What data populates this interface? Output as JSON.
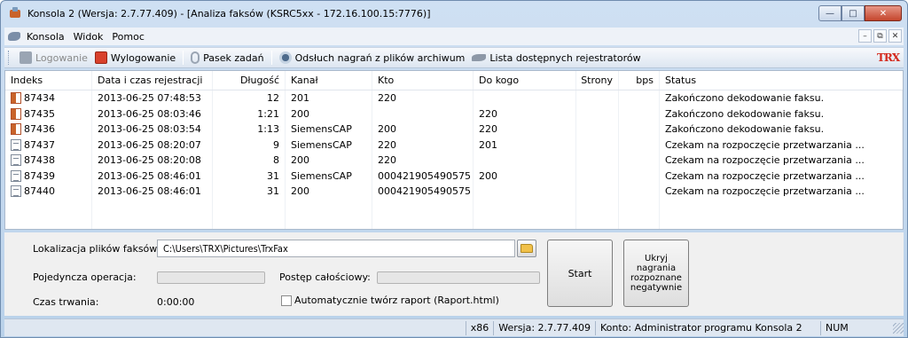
{
  "window": {
    "title": "Konsola 2 (Wersja:  2.7.77.409) - [Analiza faksów (KSRC5xx - 172.16.100.15:7776)]"
  },
  "menu": {
    "items": [
      "Konsola",
      "Widok",
      "Pomoc"
    ]
  },
  "toolbar": {
    "login": "Logowanie",
    "logout": "Wylogowanie",
    "taskbar": "Pasek zadań",
    "listen": "Odsłuch nagrań z plików archiwum",
    "recorders": "Lista dostępnych rejestratorów",
    "logo": "TRX"
  },
  "table": {
    "headers": [
      "Indeks",
      "Data i czas rejestracji",
      "Długość",
      "Kanał",
      "Kto",
      "Do kogo",
      "Strony",
      "bps",
      "Status"
    ],
    "rows": [
      {
        "icon": "fax-icon",
        "id": "87434",
        "date": "2013-06-25 07:48:53",
        "len": "12",
        "channel": "201",
        "who": "220",
        "to": "",
        "pages": "",
        "bps": "",
        "status": "Zakończono dekodowanie faksu."
      },
      {
        "icon": "fax-icon",
        "id": "87435",
        "date": "2013-06-25 08:03:46",
        "len": "1:21",
        "channel": "200",
        "who": "",
        "to": "220",
        "pages": "",
        "bps": "",
        "status": "Zakończono dekodowanie faksu."
      },
      {
        "icon": "fax-icon",
        "id": "87436",
        "date": "2013-06-25 08:03:54",
        "len": "1:13",
        "channel": "SiemensCAP",
        "who": "200",
        "to": "220",
        "pages": "",
        "bps": "",
        "status": "Zakończono dekodowanie faksu."
      },
      {
        "icon": "document-icon",
        "id": "87437",
        "date": "2013-06-25 08:20:07",
        "len": "9",
        "channel": "SiemensCAP",
        "who": "220",
        "to": "201",
        "pages": "",
        "bps": "",
        "status": "Czekam na rozpoczęcie przetwarzania ..."
      },
      {
        "icon": "document-icon",
        "id": "87438",
        "date": "2013-06-25 08:20:08",
        "len": "8",
        "channel": "200",
        "who": "220",
        "to": "",
        "pages": "",
        "bps": "",
        "status": "Czekam na rozpoczęcie przetwarzania ..."
      },
      {
        "icon": "document-icon",
        "id": "87439",
        "date": "2013-06-25 08:46:01",
        "len": "31",
        "channel": "SiemensCAP",
        "who": "000421905490575",
        "to": "200",
        "pages": "",
        "bps": "",
        "status": "Czekam na rozpoczęcie przetwarzania ..."
      },
      {
        "icon": "document-icon",
        "id": "87440",
        "date": "2013-06-25 08:46:01",
        "len": "31",
        "channel": "200",
        "who": "000421905490575",
        "to": "",
        "pages": "",
        "bps": "",
        "status": "Czekam na rozpoczęcie przetwarzania ..."
      }
    ]
  },
  "panel": {
    "location_label": "Lokalizacja plików faksów:",
    "location_value": "C:\\Users\\TRX\\Pictures\\TrxFax",
    "single_op_label": "Pojedyncza operacja:",
    "single_op_progress": 0,
    "total_label": "Postęp całościowy:",
    "total_progress": 0,
    "duration_label": "Czas trwania:",
    "duration_value": "0:00:00",
    "auto_report_label": "Automatycznie twórz raport (Raport.html)",
    "auto_report_checked": false,
    "start_label": "Start",
    "hide_label": "Ukryj nagrania rozpoznane negatywnie"
  },
  "statusbar": {
    "arch": "x86",
    "version": "Wersja: 2.7.77.409",
    "account": "Konto: Administrator programu Konsola 2",
    "num": "NUM"
  }
}
